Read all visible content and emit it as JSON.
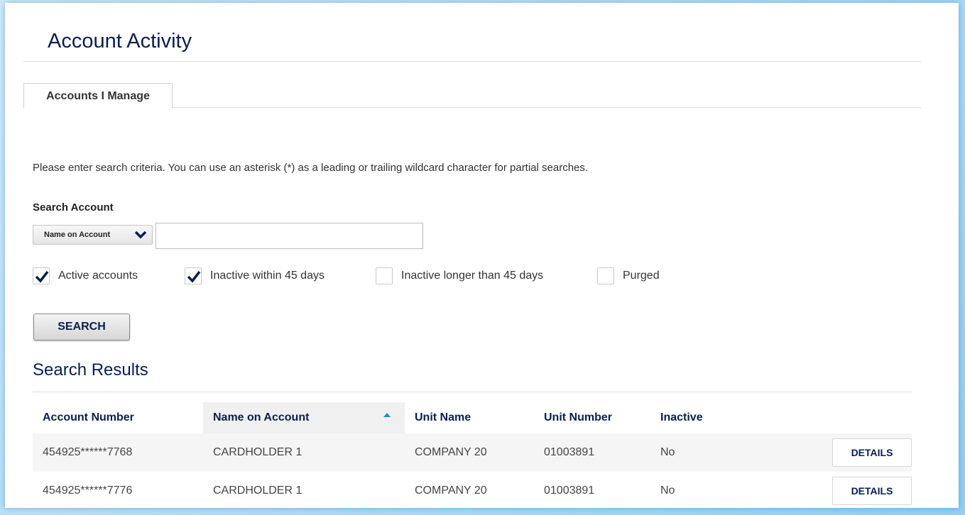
{
  "page": {
    "title": "Account Activity"
  },
  "tabs": [
    {
      "label": "Accounts I Manage",
      "active": true
    }
  ],
  "search": {
    "instructions": "Please enter search criteria. You can use an asterisk (*) as a leading or trailing wildcard character for partial searches.",
    "label": "Search Account",
    "field_select": {
      "selected": "Name on Account",
      "icon": "chevron-down-icon"
    },
    "input": {
      "value": "",
      "placeholder": ""
    },
    "filters": [
      {
        "label": "Active accounts",
        "checked": true
      },
      {
        "label": "Inactive within 45 days",
        "checked": true
      },
      {
        "label": "Inactive longer than 45 days",
        "checked": false
      },
      {
        "label": "Purged",
        "checked": false
      }
    ],
    "button_label": "SEARCH"
  },
  "results": {
    "title": "Search Results",
    "columns": [
      "Account Number",
      "Name on Account",
      "Unit Name",
      "Unit Number",
      "Inactive"
    ],
    "sorted_column": "Name on Account",
    "sort_direction": "ascending",
    "rows": [
      {
        "account_number": "454925******7768",
        "name": "CARDHOLDER 1",
        "unit_name": "COMPANY 20",
        "unit_number": "01003891",
        "inactive": "No",
        "action": "DETAILS"
      },
      {
        "account_number": "454925******7776",
        "name": "CARDHOLDER 1",
        "unit_name": "COMPANY 20",
        "unit_number": "01003891",
        "inactive": "No",
        "action": "DETAILS"
      }
    ]
  },
  "colors": {
    "heading": "#0b1f4d",
    "check": "#0b1f4d",
    "sort_arrow": "#1f8ad0",
    "background_gradient_start": "#cfe9fb",
    "background_gradient_end": "#8fd0f5"
  }
}
